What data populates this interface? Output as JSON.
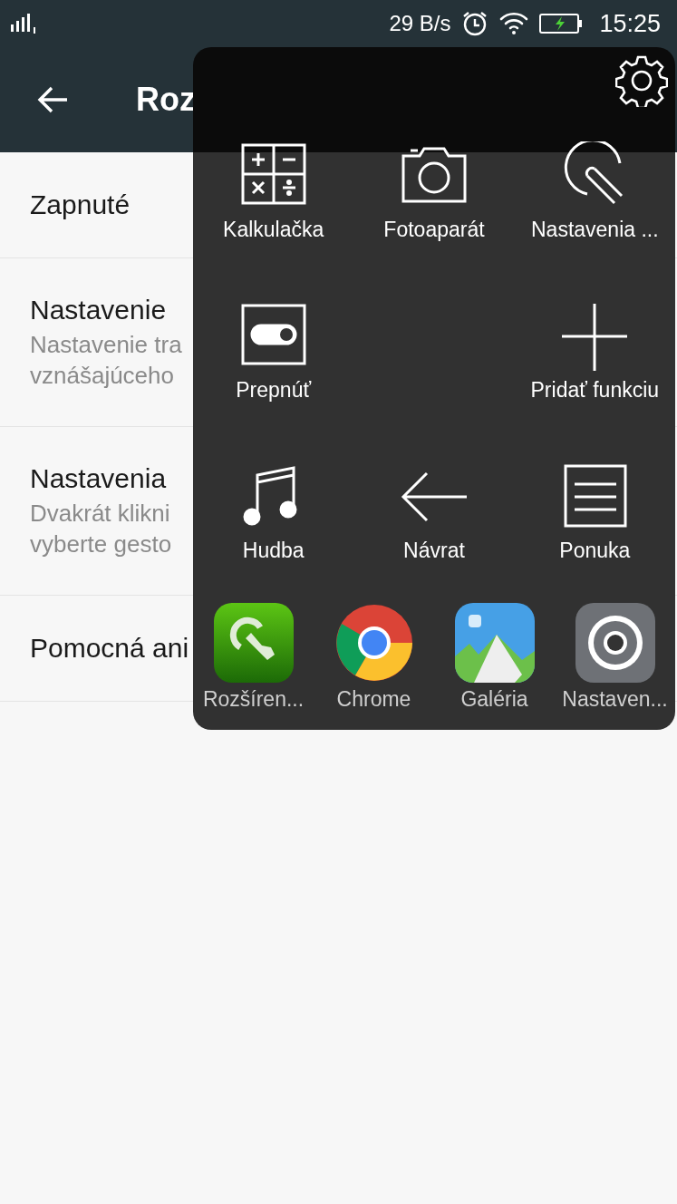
{
  "status_bar": {
    "speed": "29 B/s",
    "time": "15:25"
  },
  "header": {
    "title": "Roz"
  },
  "settings": [
    {
      "title": "Zapnuté"
    },
    {
      "title": "Nastavenie",
      "lines": [
        "Nastavenie tra",
        "vznášajúceho"
      ]
    },
    {
      "title": "Nastavenia",
      "lines": [
        "Dvakrát klikni",
        "vyberte gesto"
      ]
    },
    {
      "title": "Pomocná ani"
    }
  ],
  "floating_menu": {
    "functions": [
      {
        "kind": "calculator",
        "label": "Kalkulačka"
      },
      {
        "kind": "camera",
        "label": "Fotoaparát"
      },
      {
        "kind": "touch",
        "label": "Nastavenia ..."
      },
      {
        "kind": "toggle",
        "label": "Prepnúť"
      },
      {
        "kind": "empty"
      },
      {
        "kind": "plus",
        "label": "Pridať funkciu"
      },
      {
        "kind": "music",
        "label": "Hudba"
      },
      {
        "kind": "back",
        "label": "Návrat"
      },
      {
        "kind": "menu",
        "label": "Ponuka"
      }
    ],
    "apps": [
      {
        "kind": "touch-app",
        "label": "Rozšíren..."
      },
      {
        "kind": "chrome",
        "label": "Chrome"
      },
      {
        "kind": "gallery",
        "label": "Galéria"
      },
      {
        "kind": "settings",
        "label": "Nastaven..."
      }
    ]
  }
}
